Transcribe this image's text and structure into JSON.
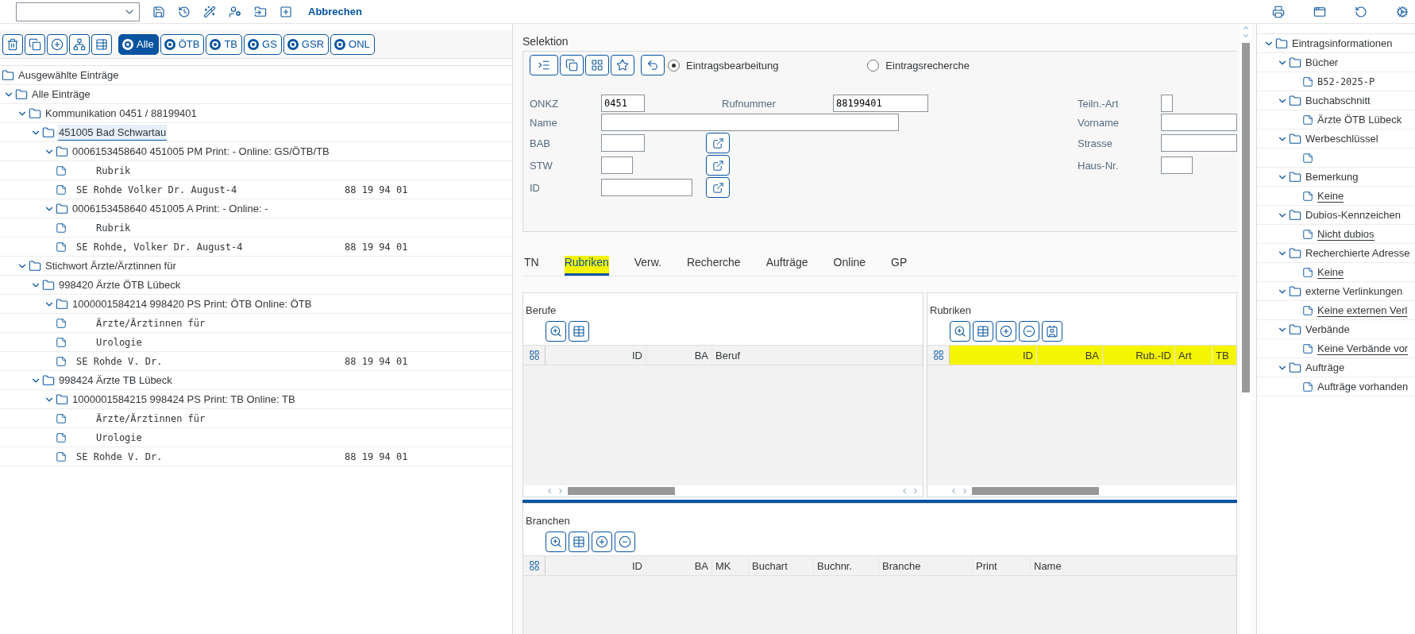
{
  "toolbar": {
    "cancel": "Abbrechen"
  },
  "filters": [
    {
      "label": "Alle",
      "selected": true
    },
    {
      "label": "ÖTB",
      "selected": false
    },
    {
      "label": "TB",
      "selected": false
    },
    {
      "label": "GS",
      "selected": false
    },
    {
      "label": "GSR",
      "selected": false
    },
    {
      "label": "ONL",
      "selected": false
    }
  ],
  "tree": [
    {
      "kind": "folder",
      "label": "Ausgewählte Einträge",
      "selected": false
    },
    {
      "kind": "folder",
      "label": "Alle Einträge",
      "expanded": true,
      "selected": false,
      "children": [
        {
          "kind": "folder",
          "label": "Kommunikation 0451 / 88199401",
          "expanded": true,
          "selected": false,
          "children": [
            {
              "kind": "folder",
              "label": "451005 Bad Schwartau",
              "expanded": true,
              "selected": true,
              "children": [
                {
                  "kind": "folder",
                  "label": "0006153458640 451005 PM Print: - Online: GS/ÖTB/TB",
                  "expanded": true,
                  "selected": false,
                  "children": [
                    {
                      "kind": "line",
                      "label": "Rubrik",
                      "selected": false
                    },
                    {
                      "kind": "entry",
                      "label": "SE Rohde Volker Dr. August-4",
                      "number": "88 19 94 01",
                      "selected": false
                    }
                  ]
                },
                {
                  "kind": "folder",
                  "label": "0006153458640 451005 A Print: - Online: -",
                  "expanded": true,
                  "selected": false,
                  "children": [
                    {
                      "kind": "line",
                      "label": "Rubrik",
                      "selected": false
                    },
                    {
                      "kind": "entry",
                      "label": "SE Rohde, Volker Dr. August-4",
                      "number": "88 19 94 01",
                      "selected": false
                    }
                  ]
                }
              ]
            }
          ]
        },
        {
          "kind": "folder",
          "label": "Stichwort Ärzte/Ärztinnen für",
          "expanded": true,
          "selected": false,
          "children": [
            {
              "kind": "folder",
              "label": "998420 Ärzte ÖTB Lübeck",
              "expanded": true,
              "selected": false,
              "children": [
                {
                  "kind": "folder",
                  "label": "1000001584214 998420 PS Print: ÖTB Online: ÖTB",
                  "expanded": true,
                  "selected": false,
                  "children": [
                    {
                      "kind": "line",
                      "label": "Ärzte/Ärztinnen für",
                      "selected": false
                    },
                    {
                      "kind": "line",
                      "label": "Urologie",
                      "selected": false
                    },
                    {
                      "kind": "entry",
                      "label": "SE Rohde V. Dr.",
                      "number": "88 19 94 01",
                      "selected": false
                    }
                  ]
                }
              ]
            },
            {
              "kind": "folder",
              "label": "998424 Ärzte TB Lübeck",
              "expanded": true,
              "selected": false,
              "children": [
                {
                  "kind": "folder",
                  "label": "1000001584215 998424 PS Print: TB Online: TB",
                  "expanded": true,
                  "selected": false,
                  "children": [
                    {
                      "kind": "line",
                      "label": "Ärzte/Ärztinnen für",
                      "selected": false
                    },
                    {
                      "kind": "line",
                      "label": "Urologie",
                      "selected": false
                    },
                    {
                      "kind": "entry",
                      "label": "SE Rohde V. Dr.",
                      "number": "88 19 94 01",
                      "selected": false
                    }
                  ]
                }
              ]
            }
          ]
        }
      ]
    }
  ],
  "selection": {
    "title": "Selektion",
    "modes": [
      {
        "label": "Eintragsbearbeitung",
        "selected": true
      },
      {
        "label": "Eintragsrecherche",
        "selected": false
      }
    ],
    "left": [
      {
        "label": "ONKZ",
        "value": "0451",
        "picker": false
      },
      {
        "label": "Name",
        "picker": false
      },
      {
        "label": "BAB",
        "picker": true
      },
      {
        "label": "STW",
        "picker": true
      },
      {
        "label": "ID",
        "picker": true
      }
    ],
    "phone": {
      "label": "Rufnummer",
      "value": "88199401"
    },
    "right": [
      {
        "label": "Teiln.-Art"
      },
      {
        "label": "Vorname"
      },
      {
        "label": "Strasse"
      },
      {
        "label": "Haus-Nr."
      }
    ]
  },
  "tabs": [
    {
      "label": "TN",
      "selected": false,
      "highlighted": false
    },
    {
      "label": "Rubriken",
      "selected": true,
      "highlighted": true
    },
    {
      "label": "Verw.",
      "selected": false,
      "highlighted": false
    },
    {
      "label": "Recherche",
      "selected": false,
      "highlighted": false
    },
    {
      "label": "Aufträge",
      "selected": false,
      "highlighted": false
    },
    {
      "label": "Online",
      "selected": false,
      "highlighted": false
    },
    {
      "label": "GP",
      "selected": false,
      "highlighted": false
    }
  ],
  "grids": [
    {
      "title": "Berufe",
      "tools": [
        {
          "kind": "zoom"
        },
        {
          "kind": "table"
        }
      ],
      "highlighted": false,
      "columns": [
        {
          "label": "ID"
        },
        {
          "label": "BA"
        },
        {
          "label": "Beruf"
        }
      ]
    },
    {
      "title": "Rubriken",
      "tools": [
        {
          "kind": "zoom"
        },
        {
          "kind": "table"
        },
        {
          "kind": "add"
        },
        {
          "kind": "remove"
        },
        {
          "kind": "contact"
        }
      ],
      "highlighted": true,
      "columns": [
        {
          "label": "ID"
        },
        {
          "label": "BA"
        },
        {
          "label": "Rub.-ID"
        },
        {
          "label": "Art"
        },
        {
          "label": "TB"
        }
      ]
    }
  ],
  "branchen": {
    "title": "Branchen",
    "tools": [
      {
        "kind": "zoom"
      },
      {
        "kind": "table"
      },
      {
        "kind": "add"
      },
      {
        "kind": "remove"
      }
    ],
    "columns": [
      {
        "label": "ID"
      },
      {
        "label": "BA"
      },
      {
        "label": "MK"
      },
      {
        "label": "Buchart"
      },
      {
        "label": "Buchnr."
      },
      {
        "label": "Branche"
      },
      {
        "label": "Print"
      },
      {
        "label": "Name"
      }
    ]
  },
  "info_tree": [
    {
      "kind": "folder",
      "label": "Eintragsinformationen",
      "expanded": true,
      "children": [
        {
          "kind": "folder",
          "label": "Bücher",
          "expanded": true,
          "children": [
            {
              "kind": "code",
              "label": "B52-2025-P"
            }
          ]
        },
        {
          "kind": "folder",
          "label": "Buchabschnitt",
          "expanded": true,
          "children": [
            {
              "kind": "text",
              "label": "Ärzte ÖTB Lübeck"
            }
          ]
        },
        {
          "kind": "folder",
          "label": "Werbeschlüssel",
          "expanded": true,
          "children": [
            {
              "kind": "text"
            }
          ]
        },
        {
          "kind": "folder",
          "label": "Bemerkung",
          "expanded": true,
          "children": [
            {
              "kind": "link",
              "label": "Keine"
            }
          ]
        },
        {
          "kind": "folder",
          "label": "Dubios-Kennzeichen",
          "expanded": true,
          "children": [
            {
              "kind": "link",
              "label": "Nicht dubios"
            }
          ]
        },
        {
          "kind": "folder",
          "label": "Recherchierte Adresse",
          "expanded": true,
          "children": [
            {
              "kind": "link",
              "label": "Keine"
            }
          ]
        },
        {
          "kind": "folder",
          "label": "externe Verlinkungen",
          "expanded": true,
          "children": [
            {
              "kind": "link",
              "label": "Keine externen Verl"
            }
          ]
        },
        {
          "kind": "folder",
          "label": "Verbände",
          "expanded": true,
          "children": [
            {
              "kind": "link",
              "label": "Keine Verbände vor"
            }
          ]
        },
        {
          "kind": "folder",
          "label": "Aufträge",
          "expanded": true,
          "children": [
            {
              "kind": "text",
              "label": "Aufträge vorhanden"
            }
          ]
        }
      ]
    }
  ]
}
